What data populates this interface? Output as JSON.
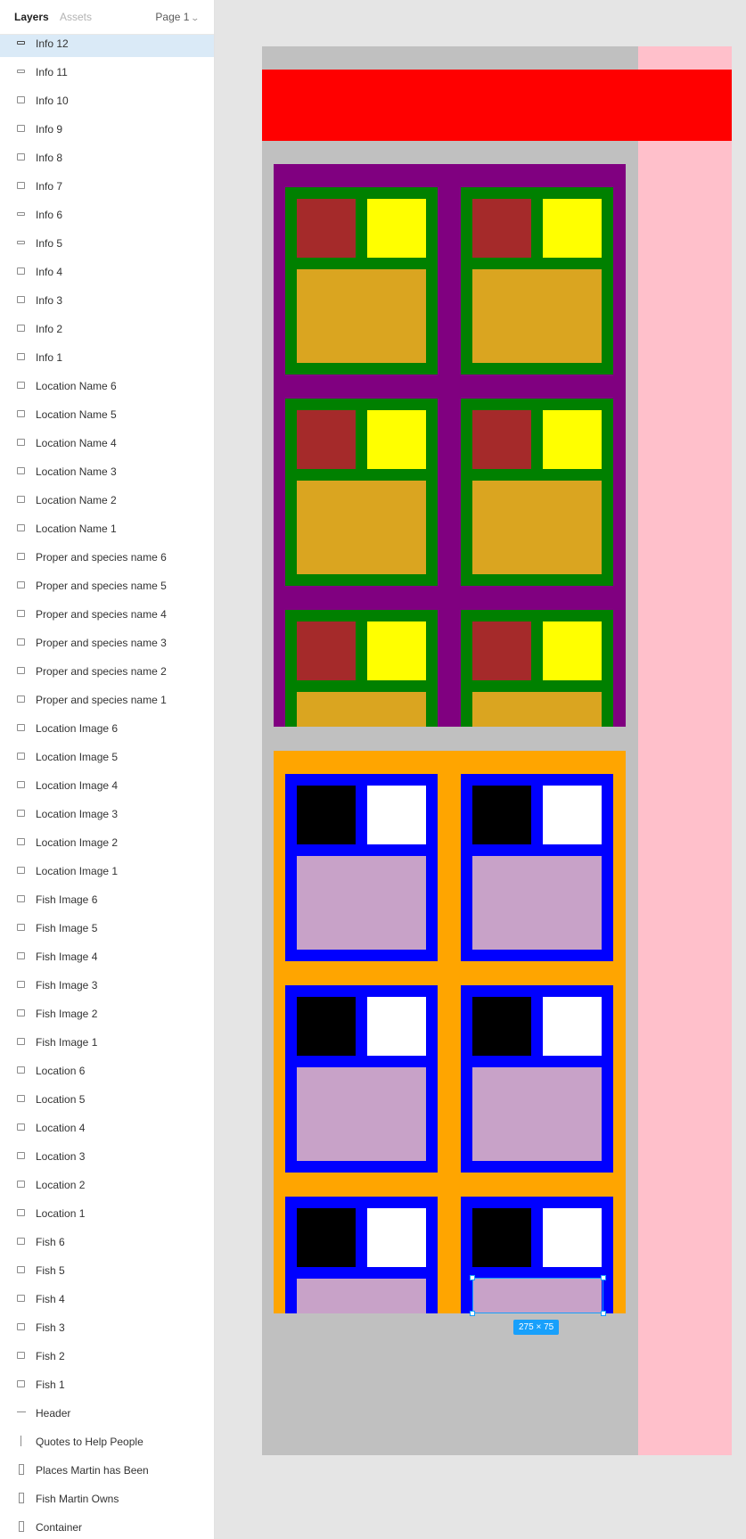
{
  "panel": {
    "tabs": {
      "layers": "Layers",
      "assets": "Assets"
    },
    "page_selector": {
      "label": "Page 1"
    },
    "layers": [
      {
        "name": "Info 12",
        "icon": "bar",
        "selected": true
      },
      {
        "name": "Info 11",
        "icon": "bar"
      },
      {
        "name": "Info 10",
        "icon": "box"
      },
      {
        "name": "Info 9",
        "icon": "box"
      },
      {
        "name": "Info 8",
        "icon": "box"
      },
      {
        "name": "Info 7",
        "icon": "box"
      },
      {
        "name": "Info 6",
        "icon": "bar"
      },
      {
        "name": "Info 5",
        "icon": "bar"
      },
      {
        "name": "Info 4",
        "icon": "box"
      },
      {
        "name": "Info 3",
        "icon": "box"
      },
      {
        "name": "Info 2",
        "icon": "box"
      },
      {
        "name": "Info 1",
        "icon": "box"
      },
      {
        "name": "Location Name 6",
        "icon": "box"
      },
      {
        "name": "Location Name 5",
        "icon": "box"
      },
      {
        "name": "Location Name 4",
        "icon": "box"
      },
      {
        "name": "Location Name 3",
        "icon": "box"
      },
      {
        "name": "Location Name 2",
        "icon": "box"
      },
      {
        "name": "Location Name 1",
        "icon": "box"
      },
      {
        "name": "Proper and species name 6",
        "icon": "box"
      },
      {
        "name": "Proper and species name 5",
        "icon": "box"
      },
      {
        "name": "Proper and species name 4",
        "icon": "box"
      },
      {
        "name": "Proper and species name 3",
        "icon": "box"
      },
      {
        "name": "Proper and species name 2",
        "icon": "box"
      },
      {
        "name": "Proper and species name 1",
        "icon": "box"
      },
      {
        "name": "Location Image 6",
        "icon": "box"
      },
      {
        "name": "Location Image 5",
        "icon": "box"
      },
      {
        "name": "Location Image 4",
        "icon": "box"
      },
      {
        "name": "Location Image 3",
        "icon": "box"
      },
      {
        "name": "Location Image 2",
        "icon": "box"
      },
      {
        "name": "Location Image 1",
        "icon": "box"
      },
      {
        "name": "Fish Image 6",
        "icon": "box"
      },
      {
        "name": "Fish Image 5",
        "icon": "box"
      },
      {
        "name": "Fish Image 4",
        "icon": "box"
      },
      {
        "name": "Fish Image 3",
        "icon": "box"
      },
      {
        "name": "Fish Image 2",
        "icon": "box"
      },
      {
        "name": "Fish Image 1",
        "icon": "box"
      },
      {
        "name": "Location 6",
        "icon": "box"
      },
      {
        "name": "Location 5",
        "icon": "box"
      },
      {
        "name": "Location 4",
        "icon": "box"
      },
      {
        "name": "Location 3",
        "icon": "box"
      },
      {
        "name": "Location 2",
        "icon": "box"
      },
      {
        "name": "Location 1",
        "icon": "box"
      },
      {
        "name": "Fish 6",
        "icon": "box"
      },
      {
        "name": "Fish 5",
        "icon": "box"
      },
      {
        "name": "Fish 4",
        "icon": "box"
      },
      {
        "name": "Fish 3",
        "icon": "box"
      },
      {
        "name": "Fish 2",
        "icon": "box"
      },
      {
        "name": "Fish 1",
        "icon": "box"
      },
      {
        "name": "Header",
        "icon": "line"
      },
      {
        "name": "Quotes to Help People",
        "icon": "vline"
      },
      {
        "name": "Places Martin has Been",
        "icon": "slim"
      },
      {
        "name": "Fish Martin Owns",
        "icon": "slim"
      },
      {
        "name": "Container",
        "icon": "slim"
      }
    ]
  },
  "canvas": {
    "selection_size_label": "275 × 75",
    "colors": {
      "background": "#e5e5e5",
      "container": "#c0c0c0",
      "quotes_column": "#ffc0cb",
      "header": "#ff0000",
      "fish_section": "#800080",
      "fish_card": "#008000",
      "fish_image": "#a52a2a",
      "proper_species_name": "#ffff00",
      "fish_info": "#daa520",
      "places_section": "#ffa500",
      "location_card": "#0000ff",
      "location_image": "#000000",
      "location_name": "#ffffff",
      "location_info": "#c8a2c8",
      "selection": "#18a0fb",
      "layer_selected": "#daeaf7"
    }
  }
}
